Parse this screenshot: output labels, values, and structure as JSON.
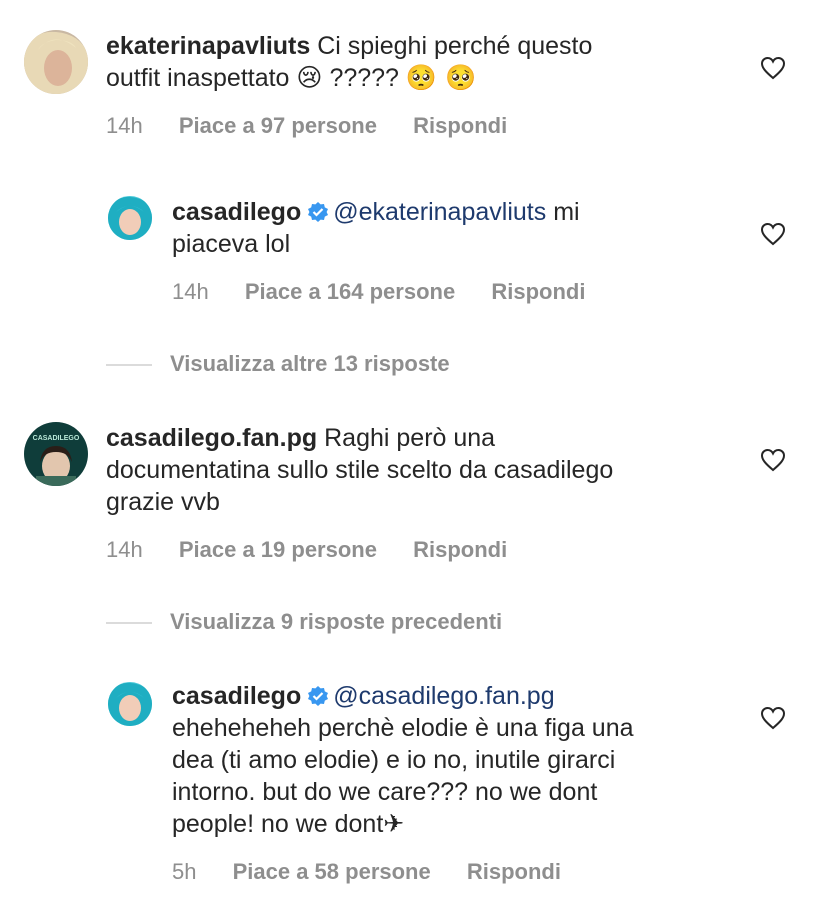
{
  "comments": [
    {
      "username": "ekaterinapavliuts",
      "text_line1": "Ci spieghi perché questo",
      "text_line2": "outfit inaspettato",
      "emoji_cry": "😢",
      "qmarks": "?????",
      "emoji_plead": "🥺 🥺",
      "time": "14h",
      "likes": "Piace a 97 persone",
      "reply": "Rispondi"
    },
    {
      "username": "casadilego",
      "mention": "@ekaterinapavliuts",
      "text_rest": "mi",
      "text_line2": "piaceva lol",
      "time": "14h",
      "likes": "Piace a 164 persone",
      "reply": "Rispondi"
    },
    {
      "username": "casadilego.fan.pg",
      "text_line1": "Raghi però una",
      "text_line2": "documentatina sullo stile scelto da casadilego",
      "text_line3": "grazie vvb",
      "time": "14h",
      "likes": "Piace a 19 persone",
      "reply": "Rispondi",
      "avatar_text": "CASADILEGO"
    },
    {
      "username": "casadilego",
      "mention": "@casadilego.fan.pg",
      "text_line2": "eheheheheh perchè elodie è una figa una",
      "text_line3": "dea (ti amo elodie) e io no, inutile girarci",
      "text_line4": "intorno. but do we care??? no we dont",
      "text_line5": "people! no we dont✈",
      "time": "5h",
      "likes": "Piace a 58 persone",
      "reply": "Rispondi"
    }
  ],
  "view_more_1": "Visualizza altre 13 risposte",
  "view_more_2": "Visualizza 9 risposte precedenti",
  "colors": {
    "mention": "#1e3a6d",
    "meta": "#8e8e8e",
    "verified": "#3897f0"
  }
}
